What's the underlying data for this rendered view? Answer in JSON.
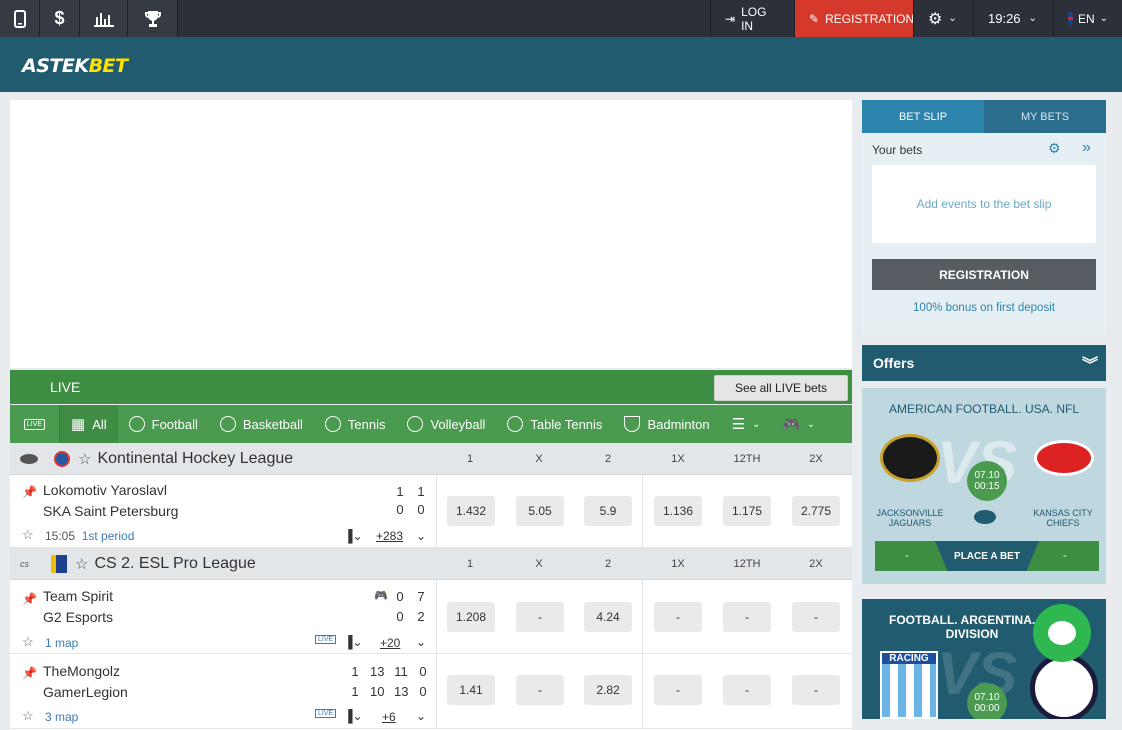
{
  "topbar": {
    "icons": [
      "mobile-icon",
      "dollar-icon",
      "stats-icon",
      "trophy-icon"
    ],
    "login": "LOG IN",
    "registration": "REGISTRATION",
    "time": "19:26",
    "language": "EN"
  },
  "header": {
    "logo_a": "ASTEK",
    "logo_b": "BET"
  },
  "live": {
    "title": "LIVE",
    "see_all": "See all LIVE bets"
  },
  "sports": {
    "all": "All",
    "tabs": [
      "Football",
      "Basketball",
      "Tennis",
      "Volleyball",
      "Table Tennis",
      "Badminton"
    ]
  },
  "columns": [
    "1",
    "X",
    "2",
    "1X",
    "12TH",
    "2X"
  ],
  "leagues": [
    {
      "name": "Kontinental Hockey League",
      "events": [
        {
          "team1": "Lokomotiv Yaroslavl",
          "team2": "SKA Saint Petersburg",
          "scores1": [
            "1",
            "1"
          ],
          "scores2": [
            "0",
            "0"
          ],
          "time": "15:05",
          "period": "1st period",
          "more": "+283",
          "odds": [
            "1.432",
            "5.05",
            "5.9",
            "1.136",
            "1.175",
            "2.775"
          ]
        }
      ]
    },
    {
      "name": "CS 2. ESL Pro League",
      "events": [
        {
          "team1": "Team Spirit",
          "team2": "G2 Esports",
          "scores1": [
            "0",
            "7"
          ],
          "scores2": [
            "0",
            "2"
          ],
          "period": "1 map",
          "more": "+20",
          "odds": [
            "1.208",
            "-",
            "4.24",
            "-",
            "-",
            "-"
          ]
        },
        {
          "team1": "TheMongolz",
          "team2": "GamerLegion",
          "scores1": [
            "1",
            "13",
            "11",
            "0"
          ],
          "scores2": [
            "1",
            "10",
            "13",
            "0"
          ],
          "period": "3 map",
          "more": "+6",
          "odds": [
            "1.41",
            "-",
            "2.82",
            "-",
            "-",
            "-"
          ]
        }
      ]
    }
  ],
  "betslip": {
    "tab_slip": "BET SLIP",
    "tab_mybets": "MY BETS",
    "your_bets": "Your bets",
    "empty": "Add events to the bet slip",
    "registration": "REGISTRATION",
    "bonus": "100% bonus on first deposit"
  },
  "offers": {
    "title": "Offers",
    "cards": [
      {
        "league": "AMERICAN FOOTBALL. USA. NFL",
        "team1": "JACKSONVILLE JAGUARS",
        "team2": "KANSAS CITY CHIEFS",
        "date": "07.10",
        "time": "00:15",
        "odd1": "-",
        "odd2": "-",
        "place": "PLACE A BET"
      },
      {
        "league": "FOOTBALL. ARGENTINA. P... DIVISION",
        "team1": "RACING",
        "date": "07.10",
        "time": "00:00"
      }
    ]
  },
  "colors": {
    "accent_green": "#3d8d42",
    "header_blue": "#215b70",
    "registration_red": "#d4392b"
  }
}
